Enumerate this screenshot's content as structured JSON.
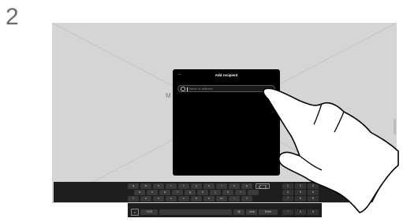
{
  "step_number": "2",
  "background": {
    "partial_label": "M"
  },
  "dialog": {
    "back_glyph": "←",
    "title": "Add recipient",
    "search": {
      "placeholder": "Name or address",
      "value": ""
    }
  },
  "keyboard": {
    "row1": [
      "q",
      "w",
      "e",
      "r",
      "t",
      "y",
      "u",
      "i",
      "o",
      "p"
    ],
    "row2": [
      "a",
      "s",
      "d",
      "f",
      "g",
      "h",
      "j",
      "k",
      "l",
      "-"
    ],
    "row3": [
      "⇧",
      "z",
      "x",
      "c",
      "v",
      "b",
      "n",
      "m",
      "/",
      "⇧"
    ],
    "bottom": {
      "mode_label": "?123",
      "at_label": "@",
      "com_label": ".com",
      "enter_label": "Enter"
    },
    "numpad": [
      "1",
      "2",
      "3",
      "4",
      "5",
      "6",
      "7",
      "8",
      "9",
      "*",
      "0",
      "#"
    ]
  },
  "colors": {
    "screen_bg": "#d5d5d5",
    "dialog_bg": "#000000",
    "keyboard_bg": "#1e1e1e"
  }
}
